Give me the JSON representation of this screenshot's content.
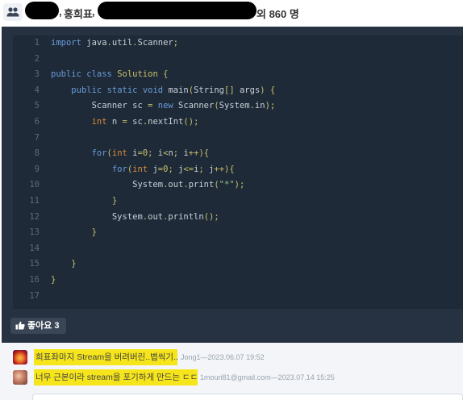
{
  "header": {
    "people_icon": "group-icon",
    "name_1_suffix": ",",
    "name_2": "홍희표",
    "name_2_suffix": ",",
    "count_text": "외 860 명"
  },
  "code": {
    "lines": [
      {
        "n": "1",
        "text": "import java.util.Scanner;"
      },
      {
        "n": "2",
        "text": ""
      },
      {
        "n": "3",
        "text": "public class Solution {"
      },
      {
        "n": "4",
        "text": "    public static void main(String[] args) {"
      },
      {
        "n": "5",
        "text": "        Scanner sc = new Scanner(System.in);"
      },
      {
        "n": "6",
        "text": "        int n = sc.nextInt();"
      },
      {
        "n": "7",
        "text": ""
      },
      {
        "n": "8",
        "text": "        for(int i=0; i<n; i++){"
      },
      {
        "n": "9",
        "text": "            for(int j=0; j<=i; j++){"
      },
      {
        "n": "10",
        "text": "                System.out.print(\"*\");"
      },
      {
        "n": "11",
        "text": "            }"
      },
      {
        "n": "12",
        "text": "            System.out.println();"
      },
      {
        "n": "13",
        "text": "        }"
      },
      {
        "n": "14",
        "text": ""
      },
      {
        "n": "15",
        "text": "    }"
      },
      {
        "n": "16",
        "text": "}"
      },
      {
        "n": "17",
        "text": ""
      }
    ]
  },
  "like": {
    "icon": "thumbs-up-icon",
    "label": "좋아요 3"
  },
  "comments": [
    {
      "text": "희표좌마지 Stream을 버려버린..볍씩기...",
      "meta": "Jong1—2023.06.07 19:52"
    },
    {
      "text": "너무 근본이라 stream을 포기하게 만드는 ㄷㄷ",
      "meta": "1mouri81@gmail.com—2023.07.14 15:25"
    }
  ],
  "colors": {
    "panel_bg": "#263141",
    "code_bg": "#1e2a38",
    "highlight": "#f6e51a"
  }
}
